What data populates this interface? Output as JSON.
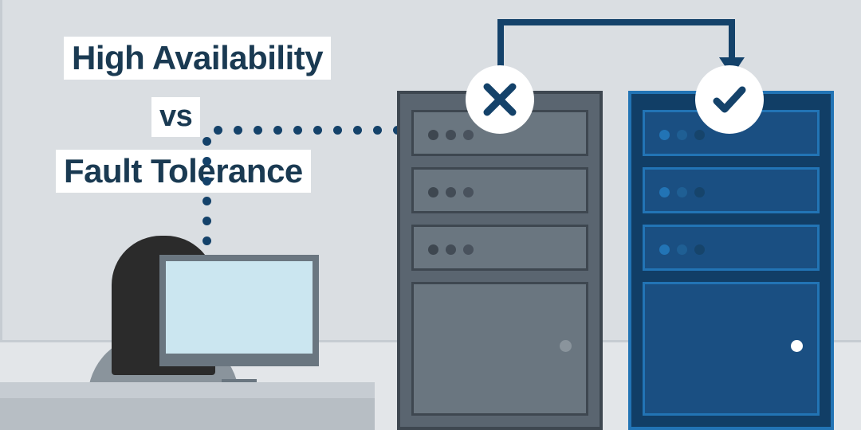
{
  "title": {
    "line1": "High Availability",
    "vs": "vs",
    "line2": "Fault Tolerance"
  },
  "servers": {
    "failed": {
      "status": "failed",
      "icon": "x"
    },
    "active": {
      "status": "active",
      "icon": "check"
    }
  },
  "colors": {
    "darkBlue": "#14426a",
    "serverGray": "#5a6570",
    "serverBlue": "#113e66",
    "accentBlue": "#2274b5",
    "bgGray": "#dadee2"
  }
}
